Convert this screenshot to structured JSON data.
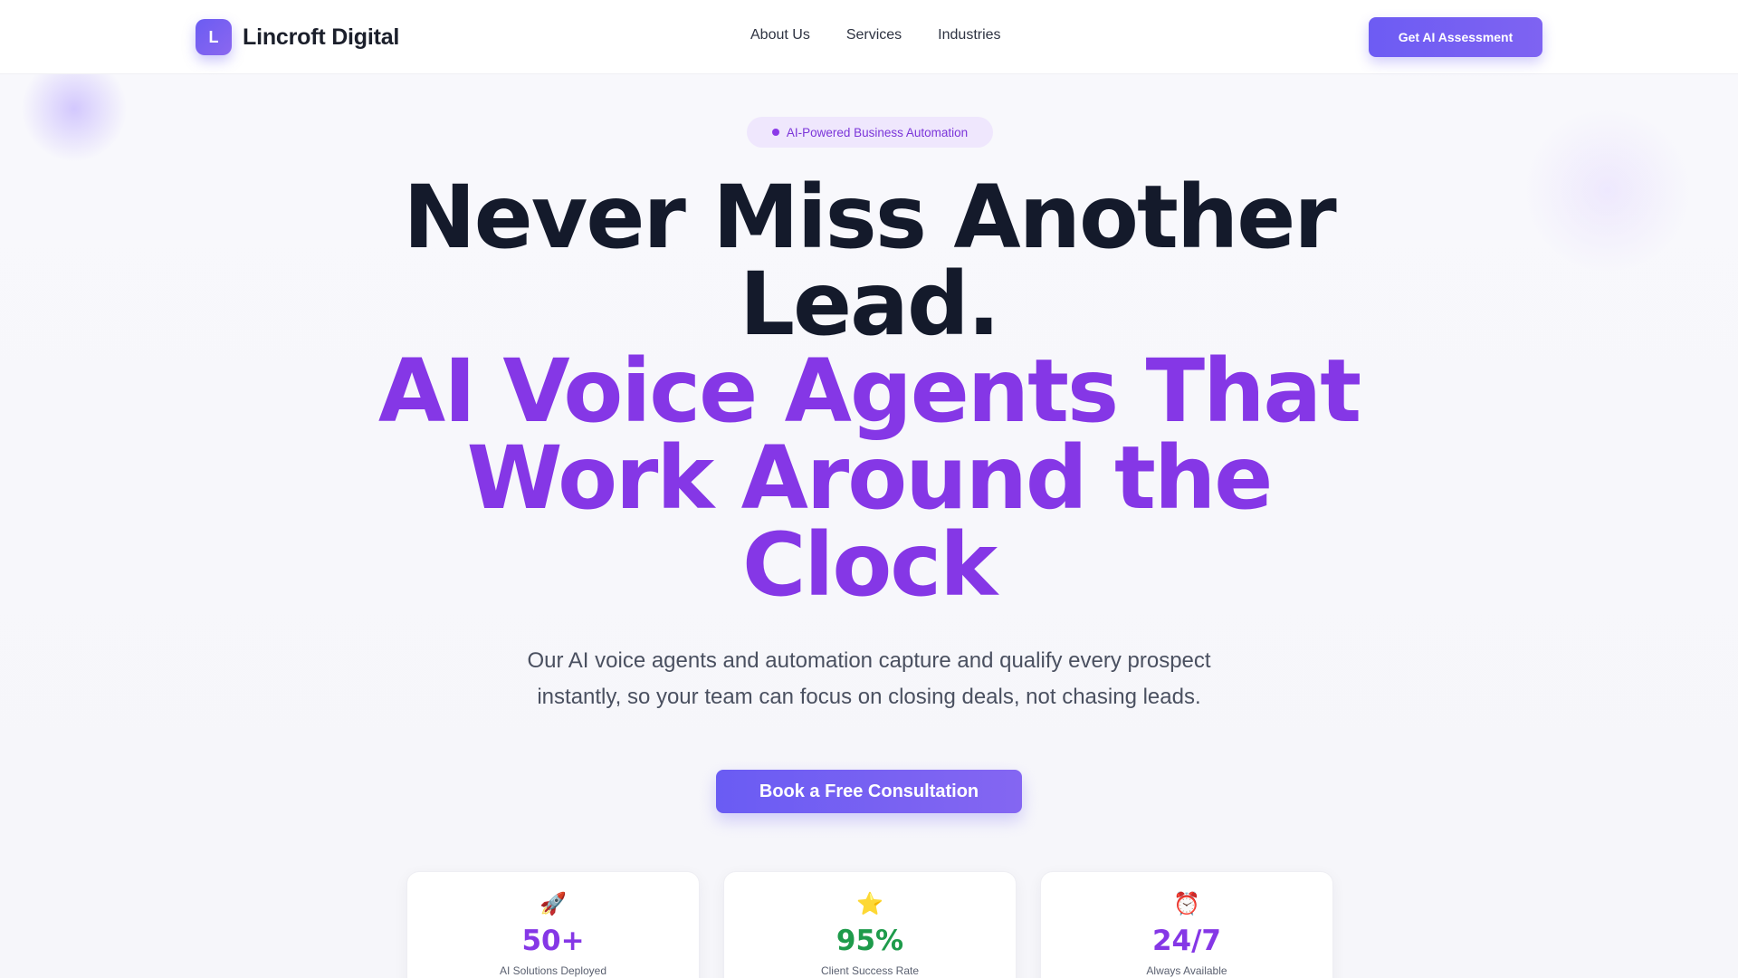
{
  "header": {
    "brand_initial": "L",
    "brand_name": "Lincroft Digital",
    "nav": [
      {
        "label": "About Us"
      },
      {
        "label": "Services"
      },
      {
        "label": "Industries"
      }
    ],
    "cta_label": "Get AI Assessment"
  },
  "hero": {
    "badge": "AI-Powered Business Automation",
    "headline_line1": "Never Miss Another",
    "headline_line2": "Lead.",
    "headline_accent_line1": "AI Voice Agents That",
    "headline_accent_line2": "Work Around the",
    "headline_accent_line3": "Clock",
    "subtext_line1": "Our AI voice agents and automation capture and qualify every prospect",
    "subtext_line2": "instantly, so your team can focus on closing deals, not chasing leads.",
    "cta_label": "Book a Free Consultation"
  },
  "stats": [
    {
      "icon": "🚀",
      "icon_name": "rocket-icon",
      "value": "50+",
      "label": "AI Solutions Deployed",
      "color": "#8537e6"
    },
    {
      "icon": "⭐",
      "icon_name": "star-icon",
      "value": "95%",
      "label": "Client Success Rate",
      "color": "#1e9b4b"
    },
    {
      "icon": "⏰",
      "icon_name": "alarm-clock-icon",
      "value": "24/7",
      "label": "Always Available",
      "color": "#8537e6"
    }
  ],
  "colors": {
    "brand": "#6d5cf3",
    "accent_purple": "#8537e6",
    "success_green": "#1e9b4b",
    "badge_bg": "#efe7fd"
  }
}
